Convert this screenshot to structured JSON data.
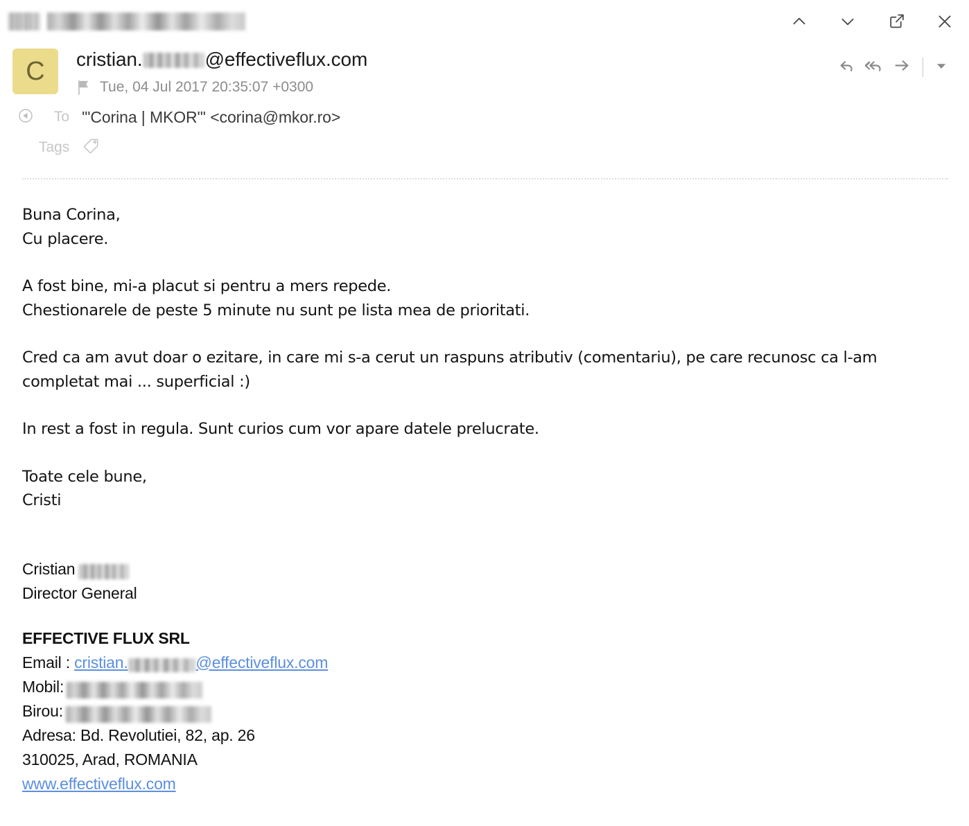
{
  "window": {
    "title_redacted": true,
    "actions": [
      {
        "name": "previous-message",
        "icon": "chevron-up-icon",
        "label": "Previous message"
      },
      {
        "name": "next-message",
        "icon": "chevron-down-icon",
        "label": "Next message"
      },
      {
        "name": "open-in-new-window",
        "icon": "external-link-icon",
        "label": "Open in new window"
      },
      {
        "name": "close",
        "icon": "close-icon",
        "label": "Close"
      }
    ]
  },
  "message": {
    "avatar_letter": "C",
    "avatar_color": "#EBDC8C",
    "avatar_text_color": "#6D6532",
    "from_prefix": "cristian.",
    "from_suffix": "@effectiveflux.com",
    "date": "Tue, 04 Jul 2017 20:35:07 +0300",
    "flag_icon": "flag-icon",
    "to_label": "To",
    "to_value": "'\"Corina | MKOR\"' <corina@mkor.ro>",
    "tags_label": "Tags",
    "tags_value": "",
    "reply_actions": [
      {
        "name": "reply-button",
        "icon": "reply-icon",
        "label": "Reply"
      },
      {
        "name": "reply-all-button",
        "icon": "reply-all-icon",
        "label": "Reply all"
      },
      {
        "name": "forward-button",
        "icon": "forward-arrow-icon",
        "label": "Forward"
      },
      {
        "name": "more-actions-button",
        "icon": "caret-down-icon",
        "label": "More"
      }
    ]
  },
  "body": {
    "paragraphs": [
      {
        "lines": [
          "Buna Corina,",
          "Cu placere."
        ]
      },
      {
        "lines": [
          "A fost bine, mi-a placut si pentru a mers repede.",
          "Chestionarele de peste 5 minute nu sunt pe lista mea de prioritati."
        ]
      },
      {
        "lines": [
          "Cred ca am avut doar o ezitare, in care mi s-a cerut un raspuns atributiv (comentariu), pe care recunosc ca l-am completat mai ... superficial :)"
        ]
      },
      {
        "lines": [
          "In rest a fost in regula. Sunt curios cum vor apare datele prelucrate."
        ]
      },
      {
        "lines": [
          "Toate cele bune,",
          "Cristi"
        ]
      }
    ]
  },
  "signature": {
    "person_first_name": "Cristian",
    "person_last_name_redacted": true,
    "job_title": "Director General",
    "company": "EFFECTIVE FLUX SRL",
    "email_label": "Email : ",
    "email_prefix": "cristian.",
    "email_suffix": "@effectiveflux.com",
    "mobile_label": "Mobil:",
    "mobile_value_redacted": true,
    "office_label": "Birou:",
    "office_value_redacted": true,
    "address_line": "Adresa: Bd. Revolutiei, 82, ap. 26",
    "city_line": "310025, Arad, ROMANIA",
    "website": "www.effectiveflux.com"
  },
  "colors": {
    "link": "#5B8FDE",
    "text": "#131313",
    "muted": "#8C8C8C",
    "label": "#C6C6C6",
    "divider": "#DCDCDC"
  }
}
